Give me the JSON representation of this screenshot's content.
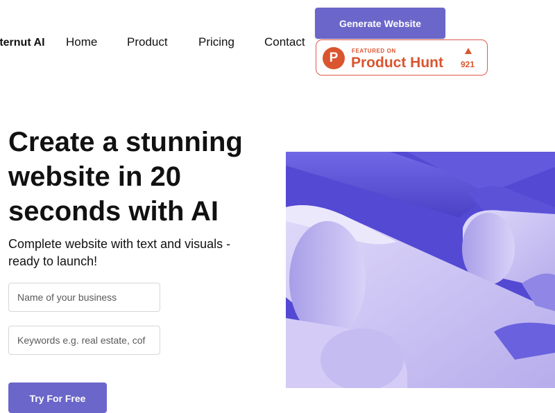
{
  "header": {
    "brand": "tternut AI",
    "nav": [
      "Home",
      "Product",
      "Pricing",
      "Contact"
    ],
    "cta_label": "Generate Website",
    "product_hunt": {
      "small_label": "FEATURED ON",
      "title": "Product Hunt",
      "logo_letter": "P",
      "count": "921"
    }
  },
  "hero": {
    "title": "Create a stunning website in 20 seconds with AI",
    "subtitle": "Complete website with text and visuals - ready to launch!",
    "inputs": {
      "business_placeholder": "Name of your business",
      "keywords_placeholder": "Keywords e.g. real estate, cof"
    },
    "cta_label": "Try For Free"
  },
  "colors": {
    "accent": "#6b66c9",
    "product_hunt": "#da552f",
    "art_dark": "#5a4fd6",
    "art_light": "#cfc7f3"
  },
  "icons": {
    "product_hunt_logo": "product-hunt-logo-icon",
    "upvote": "upvote-triangle-icon"
  }
}
